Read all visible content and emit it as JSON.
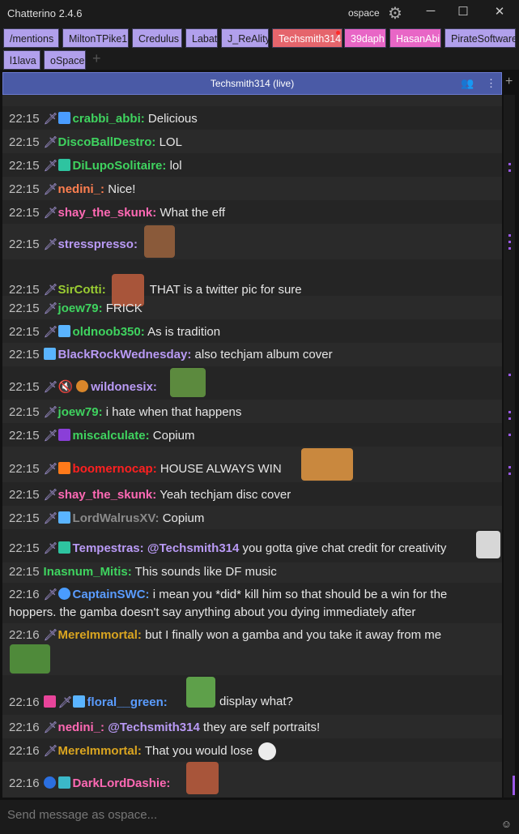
{
  "window": {
    "title": "Chatterino 2.4.6",
    "username": "ospace",
    "minimize": "─",
    "maximize": "☐",
    "close": "✕"
  },
  "tabs": [
    {
      "label": "/mentions",
      "state": "normal"
    },
    {
      "label": "MiltonTPike1",
      "state": "normal"
    },
    {
      "label": "Credulus",
      "state": "normal"
    },
    {
      "label": "Labat",
      "state": "normal"
    },
    {
      "label": "J_ReAlity",
      "state": "normal"
    },
    {
      "label": "Techsmith314",
      "state": "selected"
    },
    {
      "label": "39daph",
      "state": "highlight"
    },
    {
      "label": "HasanAbi",
      "state": "highlight"
    },
    {
      "label": "PirateSoftware",
      "state": "normal"
    },
    {
      "label": "l1lava",
      "state": "normal"
    },
    {
      "label": "oSpace",
      "state": "normal"
    }
  ],
  "split": {
    "title": "Techsmith314 (live)"
  },
  "colors": {
    "accent": "#4a5aa6",
    "scroll_marker": "#9b59e8"
  },
  "messages": [
    {
      "time": "22:15",
      "user": "crabbi_abbi:",
      "user_color": "#3fd35f",
      "text": "Delicious"
    },
    {
      "time": "22:15",
      "user": "DiscoBallDestro:",
      "user_color": "#3fd35f",
      "text": "LOL"
    },
    {
      "time": "22:15",
      "user": "DiLupoSolitaire:",
      "user_color": "#3fd35f",
      "text": "lol"
    },
    {
      "time": "22:15",
      "user": "nedini_:",
      "user_color": "#ff7f50",
      "text": "Nice!"
    },
    {
      "time": "22:15",
      "user": "shay_the_skunk:",
      "user_color": "#ff69b4",
      "text": "What the eff"
    },
    {
      "time": "22:15",
      "user": "stresspresso:",
      "user_color": "#b99af5",
      "text": ""
    },
    {
      "time": "22:15",
      "user": "SirCotti:",
      "user_color": "#9acd32",
      "text": "THAT is a twitter pic for sure"
    },
    {
      "time": "22:15",
      "user": "joew79:",
      "user_color": "#3fd35f",
      "text": "FRICK"
    },
    {
      "time": "22:15",
      "user": "oldnoob350:",
      "user_color": "#3fd35f",
      "text": "As is tradition"
    },
    {
      "time": "22:15",
      "user": "BlackRockWednesday:",
      "user_color": "#b99af5",
      "text": "also techjam album cover"
    },
    {
      "time": "22:15",
      "user": "wildonesix:",
      "user_color": "#b99af5",
      "text": ""
    },
    {
      "time": "22:15",
      "user": "joew79:",
      "user_color": "#3fd35f",
      "text": "i hate when that happens"
    },
    {
      "time": "22:15",
      "user": "miscalculate:",
      "user_color": "#3fd35f",
      "text": "Copium"
    },
    {
      "time": "22:15",
      "user": "boomernocap:",
      "user_color": "#ff2020",
      "text": "HOUSE ALWAYS WIN"
    },
    {
      "time": "22:15",
      "user": "shay_the_skunk:",
      "user_color": "#ff69b4",
      "text": "Yeah techjam disc cover"
    },
    {
      "time": "22:15",
      "user": "LordWalrusXV:",
      "user_color": "#8a8a8a",
      "text": "Copium"
    },
    {
      "time": "22:15",
      "user": "Tempestras:",
      "user_color": "#b99af5",
      "mention": "@Techsmith314",
      "text": "you gotta give chat credit for creativity"
    },
    {
      "time": "22:15",
      "user": "Inasnum_Mitis:",
      "user_color": "#3fd35f",
      "text": "This sounds like DF music"
    },
    {
      "time": "22:16",
      "user": "CaptainSWC:",
      "user_color": "#5a9cff",
      "text": "i mean you *did* kill him so that should be a win for the hoppers. the gamba doesn't say anything about you dying immediately after"
    },
    {
      "time": "22:16",
      "user": "MereImmortal:",
      "user_color": "#daa520",
      "text": "but I finally won a gamba and you take it away from me"
    },
    {
      "time": "22:16",
      "user": "floral__green:",
      "user_color": "#5a9cff",
      "text": "display what?"
    },
    {
      "time": "22:16",
      "user": "nedini_:",
      "user_color": "#ff69b4",
      "mention": "@Techsmith314",
      "text": "they are self portraits!"
    },
    {
      "time": "22:16",
      "user": "MereImmortal:",
      "user_color": "#daa520",
      "text": "That you would lose"
    },
    {
      "time": "22:16",
      "user": "DarkLordDashie:",
      "user_color": "#ff69b4",
      "text": ""
    }
  ],
  "input": {
    "placeholder": "Send message as ospace..."
  }
}
